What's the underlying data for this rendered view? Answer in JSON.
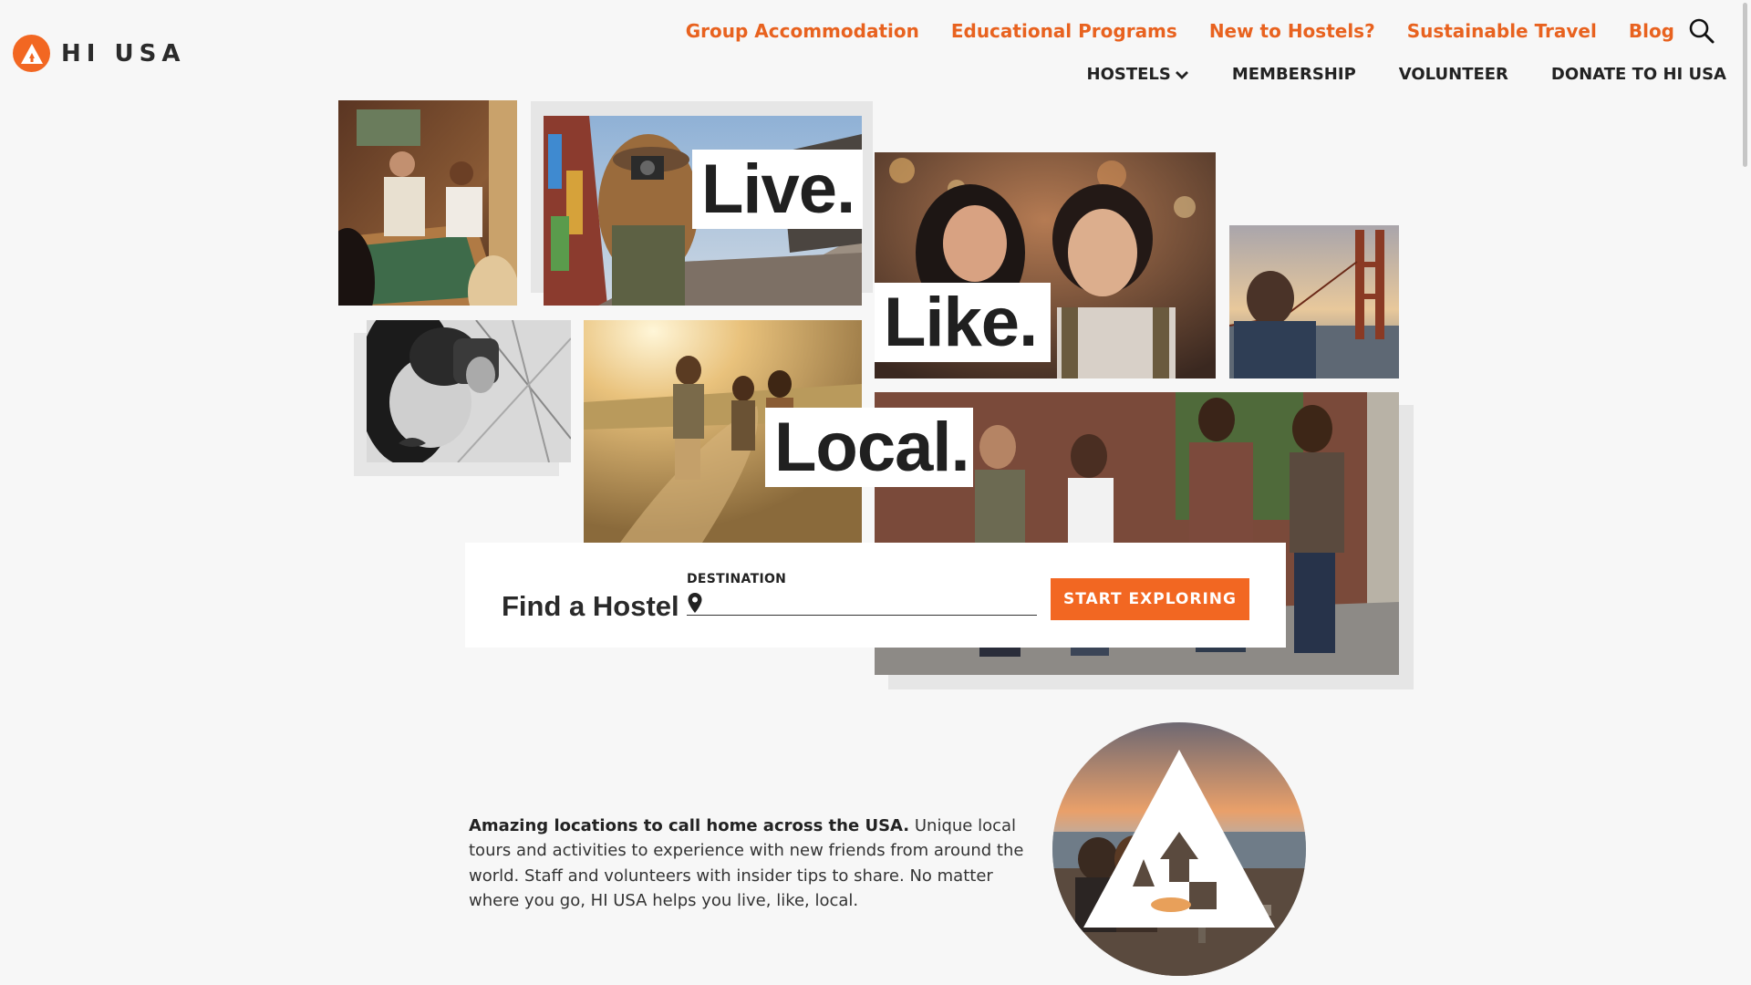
{
  "brand": {
    "name": "HI USA",
    "accent": "#f26722"
  },
  "top_nav": [
    {
      "label": "Group Accommodation"
    },
    {
      "label": "Educational Programs"
    },
    {
      "label": "New to Hostels?"
    },
    {
      "label": "Sustainable Travel"
    },
    {
      "label": "Blog"
    }
  ],
  "main_nav": [
    {
      "label": "HOSTELS",
      "icon": "chevron-down-icon"
    },
    {
      "label": "MEMBERSHIP"
    },
    {
      "label": "VOLUNTEER"
    },
    {
      "label": "DONATE TO HI USA"
    }
  ],
  "hero": {
    "words": [
      "Live.",
      "Like.",
      "Local."
    ]
  },
  "finder": {
    "title": "Find a Hostel",
    "destination_label": "DESTINATION",
    "destination_value": "",
    "button_label": "START EXPLORING"
  },
  "intro": {
    "lead": "Amazing locations to call home across the USA.",
    "body": " Unique local tours and activities to experience with new friends from around the world. Staff and volunteers with insider tips to share. No matter where you go, HI USA helps you live, like, local."
  }
}
